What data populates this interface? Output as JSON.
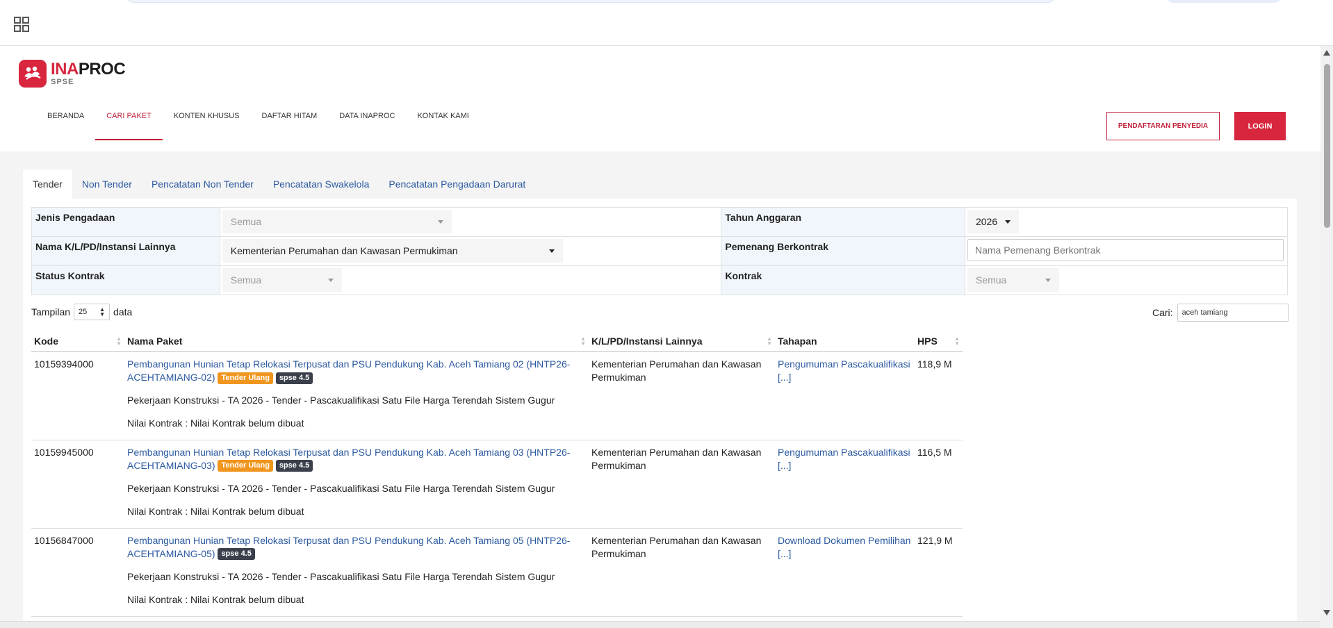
{
  "header": {
    "logo": {
      "brand_red": "INA",
      "brand_dark": "PROC",
      "sub": "SPSE",
      "color": "#d7263d"
    },
    "nav": [
      {
        "label": "BERANDA",
        "active": false
      },
      {
        "label": "CARI PAKET",
        "active": true
      },
      {
        "label": "KONTEN KHUSUS",
        "active": false
      },
      {
        "label": "DAFTAR HITAM",
        "active": false
      },
      {
        "label": "DATA INAPROC",
        "active": false
      },
      {
        "label": "KONTAK KAMI",
        "active": false
      }
    ],
    "register_label": "PENDAFTARAN PENYEDIA",
    "login_label": "LOGIN"
  },
  "tabs": [
    {
      "label": "Tender",
      "active": true
    },
    {
      "label": "Non Tender"
    },
    {
      "label": "Pencatatan Non Tender"
    },
    {
      "label": "Pencatatan Swakelola"
    },
    {
      "label": "Pencatatan Pengadaan Darurat"
    }
  ],
  "filters": {
    "jenis_label": "Jenis Pengadaan",
    "jenis_value": "Semua",
    "tahun_label": "Tahun Anggaran",
    "tahun_value": "2026",
    "instansi_label": "Nama K/L/PD/Instansi Lainnya",
    "instansi_value": "Kementerian Perumahan dan Kawasan Permukiman",
    "pemenang_label": "Pemenang Berkontrak",
    "pemenang_placeholder": "Nama Pemenang Berkontrak",
    "status_label": "Status Kontrak",
    "status_value": "Semua",
    "kontrak_label": "Kontrak",
    "kontrak_value": "Semua"
  },
  "table_controls": {
    "show_prefix": "Tampilan",
    "show_value": "25",
    "show_suffix": "data",
    "search_label": "Cari:",
    "search_value": "aceh tamiang"
  },
  "table": {
    "headers": [
      "Kode",
      "Nama Paket",
      "K/L/PD/Instansi Lainnya",
      "Tahapan",
      "HPS"
    ],
    "rows": [
      {
        "kode": "10159394000",
        "nama": "Pembangunan Hunian Tetap Relokasi Terpusat dan PSU Pendukung Kab. Aceh Tamiang 02 (HNTP26-ACEHTAMIANG-02)",
        "badge1": "Tender Ulang",
        "badge2": "spse 4.5",
        "desc": "Pekerjaan Konstruksi - TA 2026 - Tender - Pascakualifikasi Satu File Harga Terendah Sistem Gugur",
        "nilai": "Nilai Kontrak : Nilai Kontrak belum dibuat",
        "instansi": "Kementerian Perumahan dan Kawasan Permukiman",
        "tahapan": "Pengumuman Pascakualifikasi [...]",
        "hps": "118,9 M"
      },
      {
        "kode": "10159945000",
        "nama": "Pembangunan Hunian Tetap Relokasi Terpusat dan PSU Pendukung Kab. Aceh Tamiang 03 (HNTP26-ACEHTAMIANG-03)",
        "badge1": "Tender Ulang",
        "badge2": "spse 4.5",
        "desc": "Pekerjaan Konstruksi - TA 2026 - Tender - Pascakualifikasi Satu File Harga Terendah Sistem Gugur",
        "nilai": "Nilai Kontrak : Nilai Kontrak belum dibuat",
        "instansi": "Kementerian Perumahan dan Kawasan Permukiman",
        "tahapan": "Pengumuman Pascakualifikasi [...]",
        "hps": "116,5 M"
      },
      {
        "kode": "10156847000",
        "nama": "Pembangunan Hunian Tetap Relokasi Terpusat dan PSU Pendukung Kab. Aceh Tamiang 05 (HNTP26-ACEHTAMIANG-05)",
        "badge2": "spse 4.5",
        "desc": "Pekerjaan Konstruksi - TA 2026 - Tender - Pascakualifikasi Satu File Harga Terendah Sistem Gugur",
        "nilai": "Nilai Kontrak : Nilai Kontrak belum dibuat",
        "instansi": "Kementerian Perumahan dan Kawasan Permukiman",
        "tahapan": "Download Dokumen Pemilihan [...]",
        "hps": "121,9 M"
      }
    ]
  },
  "icons": {
    "apps": "grid-icon",
    "logo": "people-logo-icon",
    "caret": "caret-down-icon",
    "sort": "sort-icon"
  }
}
